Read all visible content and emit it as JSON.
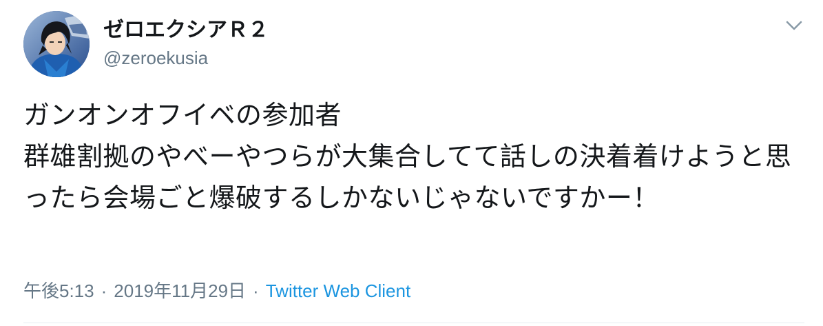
{
  "user": {
    "display_name": "ゼロエクシアＲ２",
    "handle": "@zeroekusia",
    "avatar_icon": "avatar-image"
  },
  "tweet": {
    "text": "ガンオンオフイベの参加者\n群雄割拠のやべーやつらが大集合してて話しの決着着けようと思ったら会場ごと爆破するしかないじゃないですかー！"
  },
  "meta": {
    "time": "午後5:13",
    "separator": "·",
    "date": "2019年11月29日",
    "client": "Twitter Web Client"
  },
  "colors": {
    "text": "#14171a",
    "secondary": "#657786",
    "link": "#1b95e0",
    "divider": "#e6ecf0"
  },
  "icons": {
    "menu": "chevron-down-icon"
  }
}
